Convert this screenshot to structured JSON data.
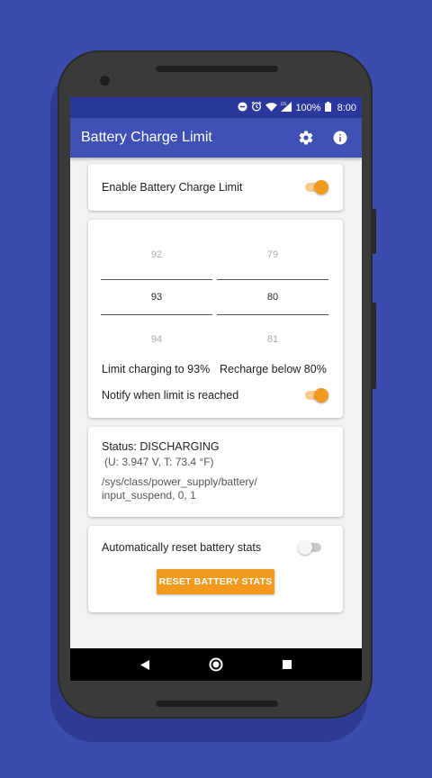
{
  "status_bar": {
    "battery_percent": "100%",
    "time": "8:00",
    "icons": [
      "dnd-icon",
      "alarm-icon",
      "wifi-icon",
      "signal-icon",
      "battery-icon"
    ]
  },
  "app_bar": {
    "title": "Battery Charge Limit",
    "actions": [
      "settings-icon",
      "info-icon"
    ]
  },
  "enable_card": {
    "label": "Enable Battery Charge Limit",
    "enabled": true
  },
  "limit_card": {
    "limit_picker": {
      "above": "92",
      "selected": "93",
      "below": "94"
    },
    "recharge_picker": {
      "above": "79",
      "selected": "80",
      "below": "81"
    },
    "limit_text": "Limit charging to 93%",
    "recharge_text": "Recharge below 80%",
    "notify_label": "Notify when limit is reached",
    "notify_enabled": true
  },
  "status_card": {
    "status": "Status: DISCHARGING",
    "details": "(U: 3.947 V, T: 73.4 °F)",
    "path_line1": "/sys/class/power_supply/battery/",
    "path_line2": "input_suspend, 0, 1"
  },
  "reset_card": {
    "label": "Automatically reset battery stats",
    "enabled": false,
    "button_label": "RESET BATTERY STATS"
  },
  "colors": {
    "background": "#3b4bae",
    "app_bar": "#3f51b5",
    "status_bar": "#2b389b",
    "accent": "#f39a1e"
  },
  "nav_bar": [
    "back-icon",
    "home-icon",
    "recents-icon"
  ]
}
